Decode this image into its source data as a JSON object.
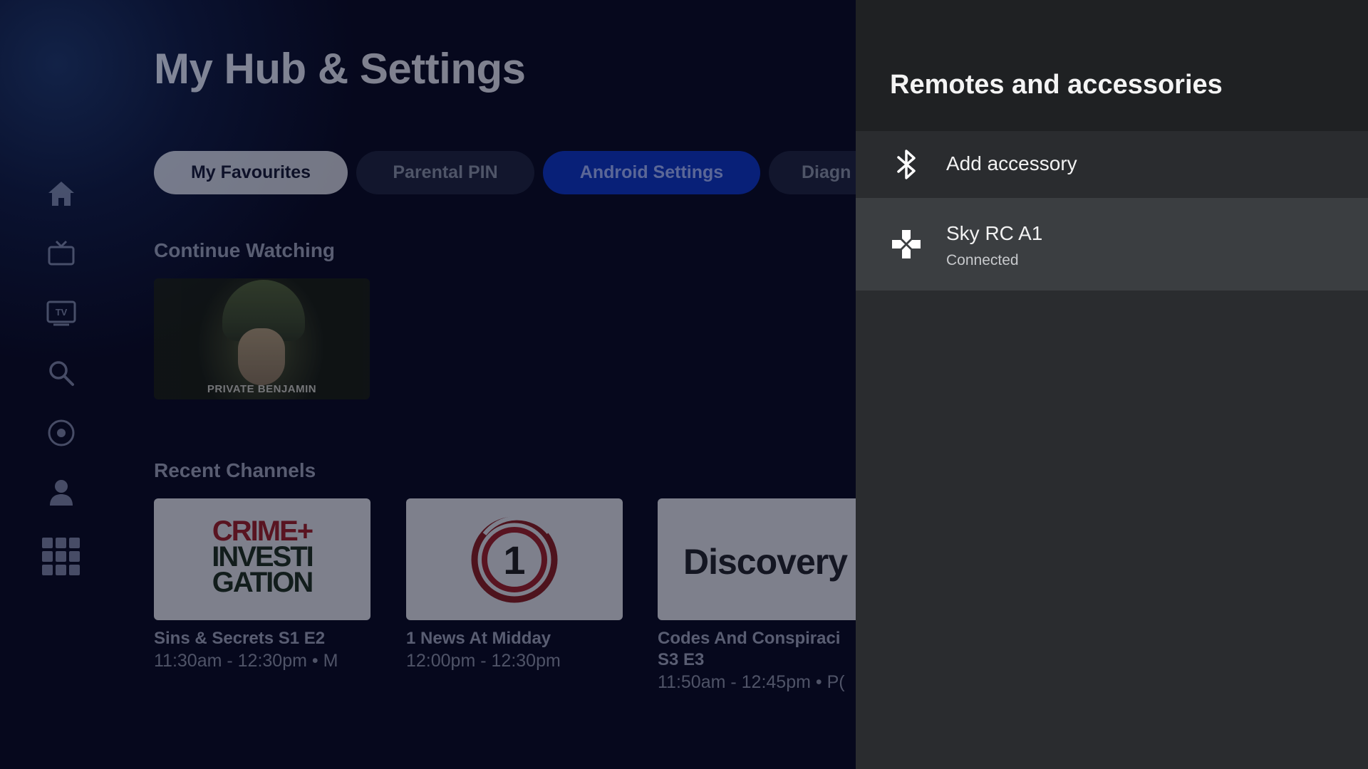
{
  "hub": {
    "title": "My Hub & Settings",
    "tabs": [
      {
        "label": "My Favourites"
      },
      {
        "label": "Parental PIN"
      },
      {
        "label": "Android Settings"
      },
      {
        "label": "Diagn"
      }
    ],
    "continue_watching": {
      "heading": "Continue Watching",
      "items": [
        {
          "caption": "PRIVATE BENJAMIN"
        }
      ]
    },
    "recent_channels": {
      "heading": "Recent Channels",
      "items": [
        {
          "logo_line1": "CRIME+",
          "logo_line2": "INVESTI",
          "logo_line3": "GATION",
          "title": "Sins & Secrets S1 E2",
          "time": "11:30am - 12:30pm • M"
        },
        {
          "logo": "1",
          "title": "1 News At Midday",
          "time": "12:00pm - 12:30pm"
        },
        {
          "logo": "Discovery",
          "title_line1": "Codes And Conspiraci",
          "title_line2": "S3 E3",
          "time": "11:50am - 12:45pm • P("
        }
      ]
    },
    "sidebar": [
      "home-icon",
      "tv-icon",
      "guide-icon",
      "search-icon",
      "record-icon",
      "profile-icon",
      "apps-grid-icon"
    ]
  },
  "panel": {
    "title": "Remotes and accessories",
    "items": [
      {
        "label": "Add accessory",
        "icon": "bluetooth-icon"
      },
      {
        "label": "Sky RC A1",
        "status": "Connected",
        "icon": "gamepad-icon"
      }
    ]
  },
  "colors": {
    "panel_bg": "#2a2c2f",
    "panel_header_bg": "#1f2123",
    "selected_item_bg": "#3b3e41",
    "active_tab": "#0a2fb0"
  }
}
